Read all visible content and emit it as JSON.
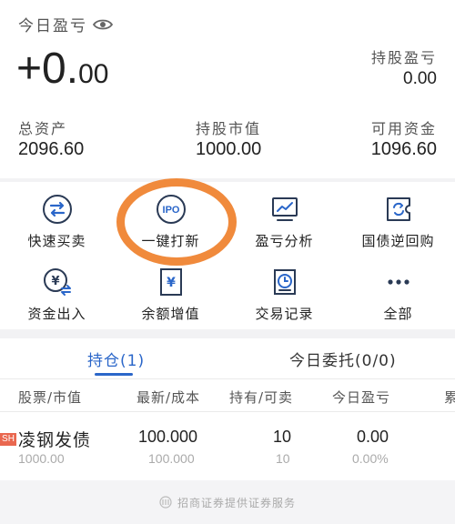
{
  "summary": {
    "today_pl_label": "今日盈亏",
    "today_pl_int": "+0.",
    "today_pl_dec": "00",
    "hold_pl_label": "持股盈亏",
    "hold_pl_value": "0.00",
    "total_assets_label": "总资产",
    "total_assets_value": "2096.60",
    "market_value_label": "持股市值",
    "market_value_value": "1000.00",
    "available_funds_label": "可用资金",
    "available_funds_value": "1096.60"
  },
  "grid": {
    "items": [
      {
        "label": "快速买卖",
        "icon": "swap-arrows-icon"
      },
      {
        "label": "一键打新",
        "icon": "ipo-icon"
      },
      {
        "label": "盈亏分析",
        "icon": "chart-monitor-icon"
      },
      {
        "label": "国债逆回购",
        "icon": "bond-repo-icon"
      },
      {
        "label": "资金出入",
        "icon": "yen-transfer-icon"
      },
      {
        "label": "余额增值",
        "icon": "yen-document-icon"
      },
      {
        "label": "交易记录",
        "icon": "clock-document-icon"
      },
      {
        "label": "全部",
        "icon": "more-dots-icon"
      }
    ]
  },
  "tabs": {
    "positions": "持仓(1)",
    "orders": "今日委托(0/0)"
  },
  "table": {
    "headers": [
      "股票/市值",
      "最新/成本",
      "持有/可卖",
      "今日盈亏",
      "累"
    ],
    "rows": [
      {
        "badge": "SH",
        "name": "凌钢发债",
        "market_value": "1000.00",
        "latest": "100.000",
        "cost": "100.000",
        "hold": "10",
        "sellable": "10",
        "today_pl": "0.00",
        "today_pl_pct": "0.00%"
      }
    ]
  },
  "footer": {
    "text": "招商证券提供证券服务"
  },
  "colors": {
    "accent": "#2a66c9",
    "highlight": "#f08a3c",
    "badge": "#e9674f"
  }
}
